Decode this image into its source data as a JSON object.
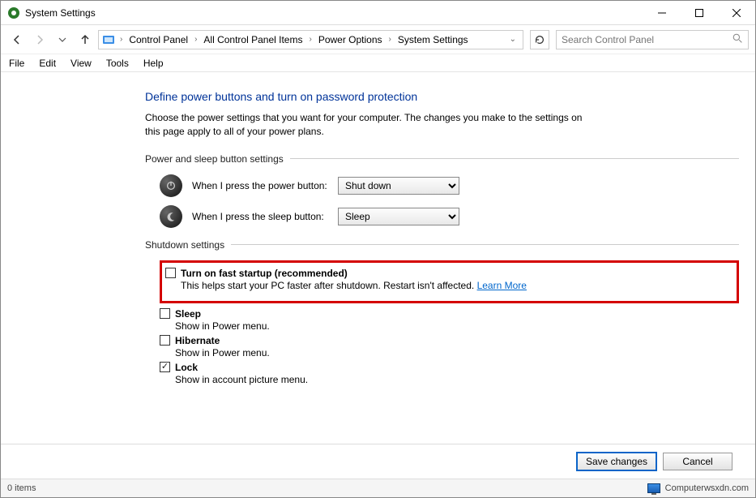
{
  "window": {
    "title": "System Settings"
  },
  "breadcrumb": {
    "items": [
      "Control Panel",
      "All Control Panel Items",
      "Power Options",
      "System Settings"
    ]
  },
  "search": {
    "placeholder": "Search Control Panel"
  },
  "menu": {
    "file": "File",
    "edit": "Edit",
    "view": "View",
    "tools": "Tools",
    "help": "Help"
  },
  "page": {
    "title": "Define power buttons and turn on password protection",
    "desc": "Choose the power settings that you want for your computer. The changes you make to the settings on this page apply to all of your power plans."
  },
  "section_buttons": {
    "heading": "Power and sleep button settings",
    "power_label": "When I press the power button:",
    "power_value": "Shut down",
    "sleep_label": "When I press the sleep button:",
    "sleep_value": "Sleep"
  },
  "section_shutdown": {
    "heading": "Shutdown settings",
    "items": [
      {
        "label": "Turn on fast startup (recommended)",
        "desc_pre": "This helps start your PC faster after shutdown. Restart isn't affected. ",
        "link": "Learn More",
        "checked": false
      },
      {
        "label": "Sleep",
        "desc": "Show in Power menu.",
        "checked": false
      },
      {
        "label": "Hibernate",
        "desc": "Show in Power menu.",
        "checked": false
      },
      {
        "label": "Lock",
        "desc": "Show in account picture menu.",
        "checked": true
      }
    ]
  },
  "actions": {
    "save": "Save changes",
    "cancel": "Cancel"
  },
  "status": {
    "left": "0 items",
    "right": "Computerwsxdn.com"
  }
}
